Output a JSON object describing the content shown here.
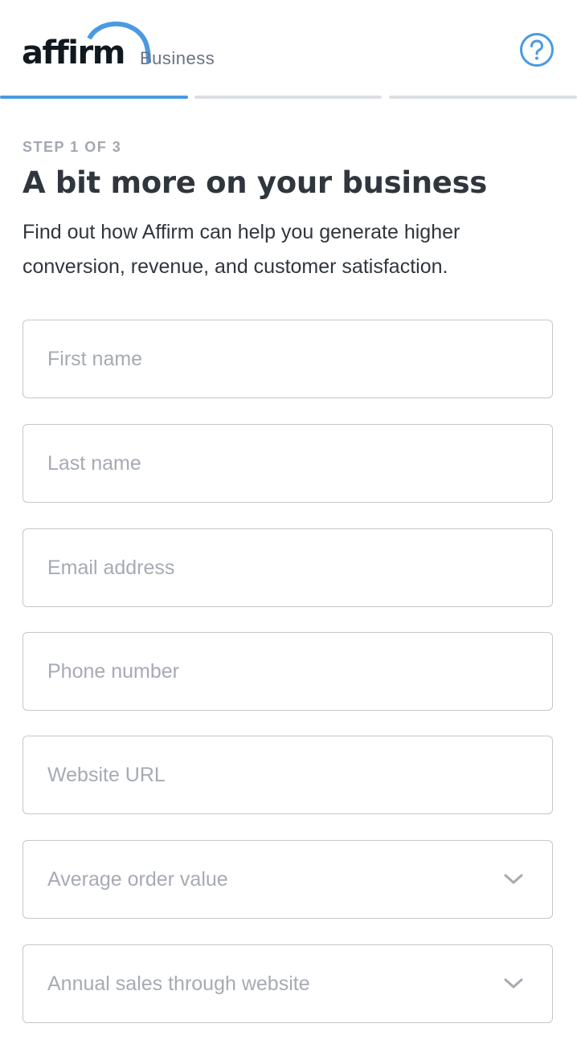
{
  "header": {
    "logo_text": "affirm",
    "logo_sub": "Business",
    "help_icon": "question-circle-icon",
    "accent_color": "#4a9ae1"
  },
  "progress": {
    "total_steps": 3,
    "current_step": 1
  },
  "step_label": "STEP 1 OF 3",
  "title": "A bit more on your business",
  "subtitle": "Find out how Affirm can help you generate higher conversion, revenue, and customer satisfaction.",
  "form": {
    "first_name": {
      "placeholder": "First name",
      "value": ""
    },
    "last_name": {
      "placeholder": "Last name",
      "value": ""
    },
    "email": {
      "placeholder": "Email address",
      "value": ""
    },
    "phone": {
      "placeholder": "Phone number",
      "value": ""
    },
    "website": {
      "placeholder": "Website URL",
      "value": ""
    },
    "average_order_value": {
      "label": "Average order value",
      "icon": "chevron-down-icon"
    },
    "annual_sales": {
      "label": "Annual sales through website",
      "icon": "chevron-down-icon"
    }
  }
}
